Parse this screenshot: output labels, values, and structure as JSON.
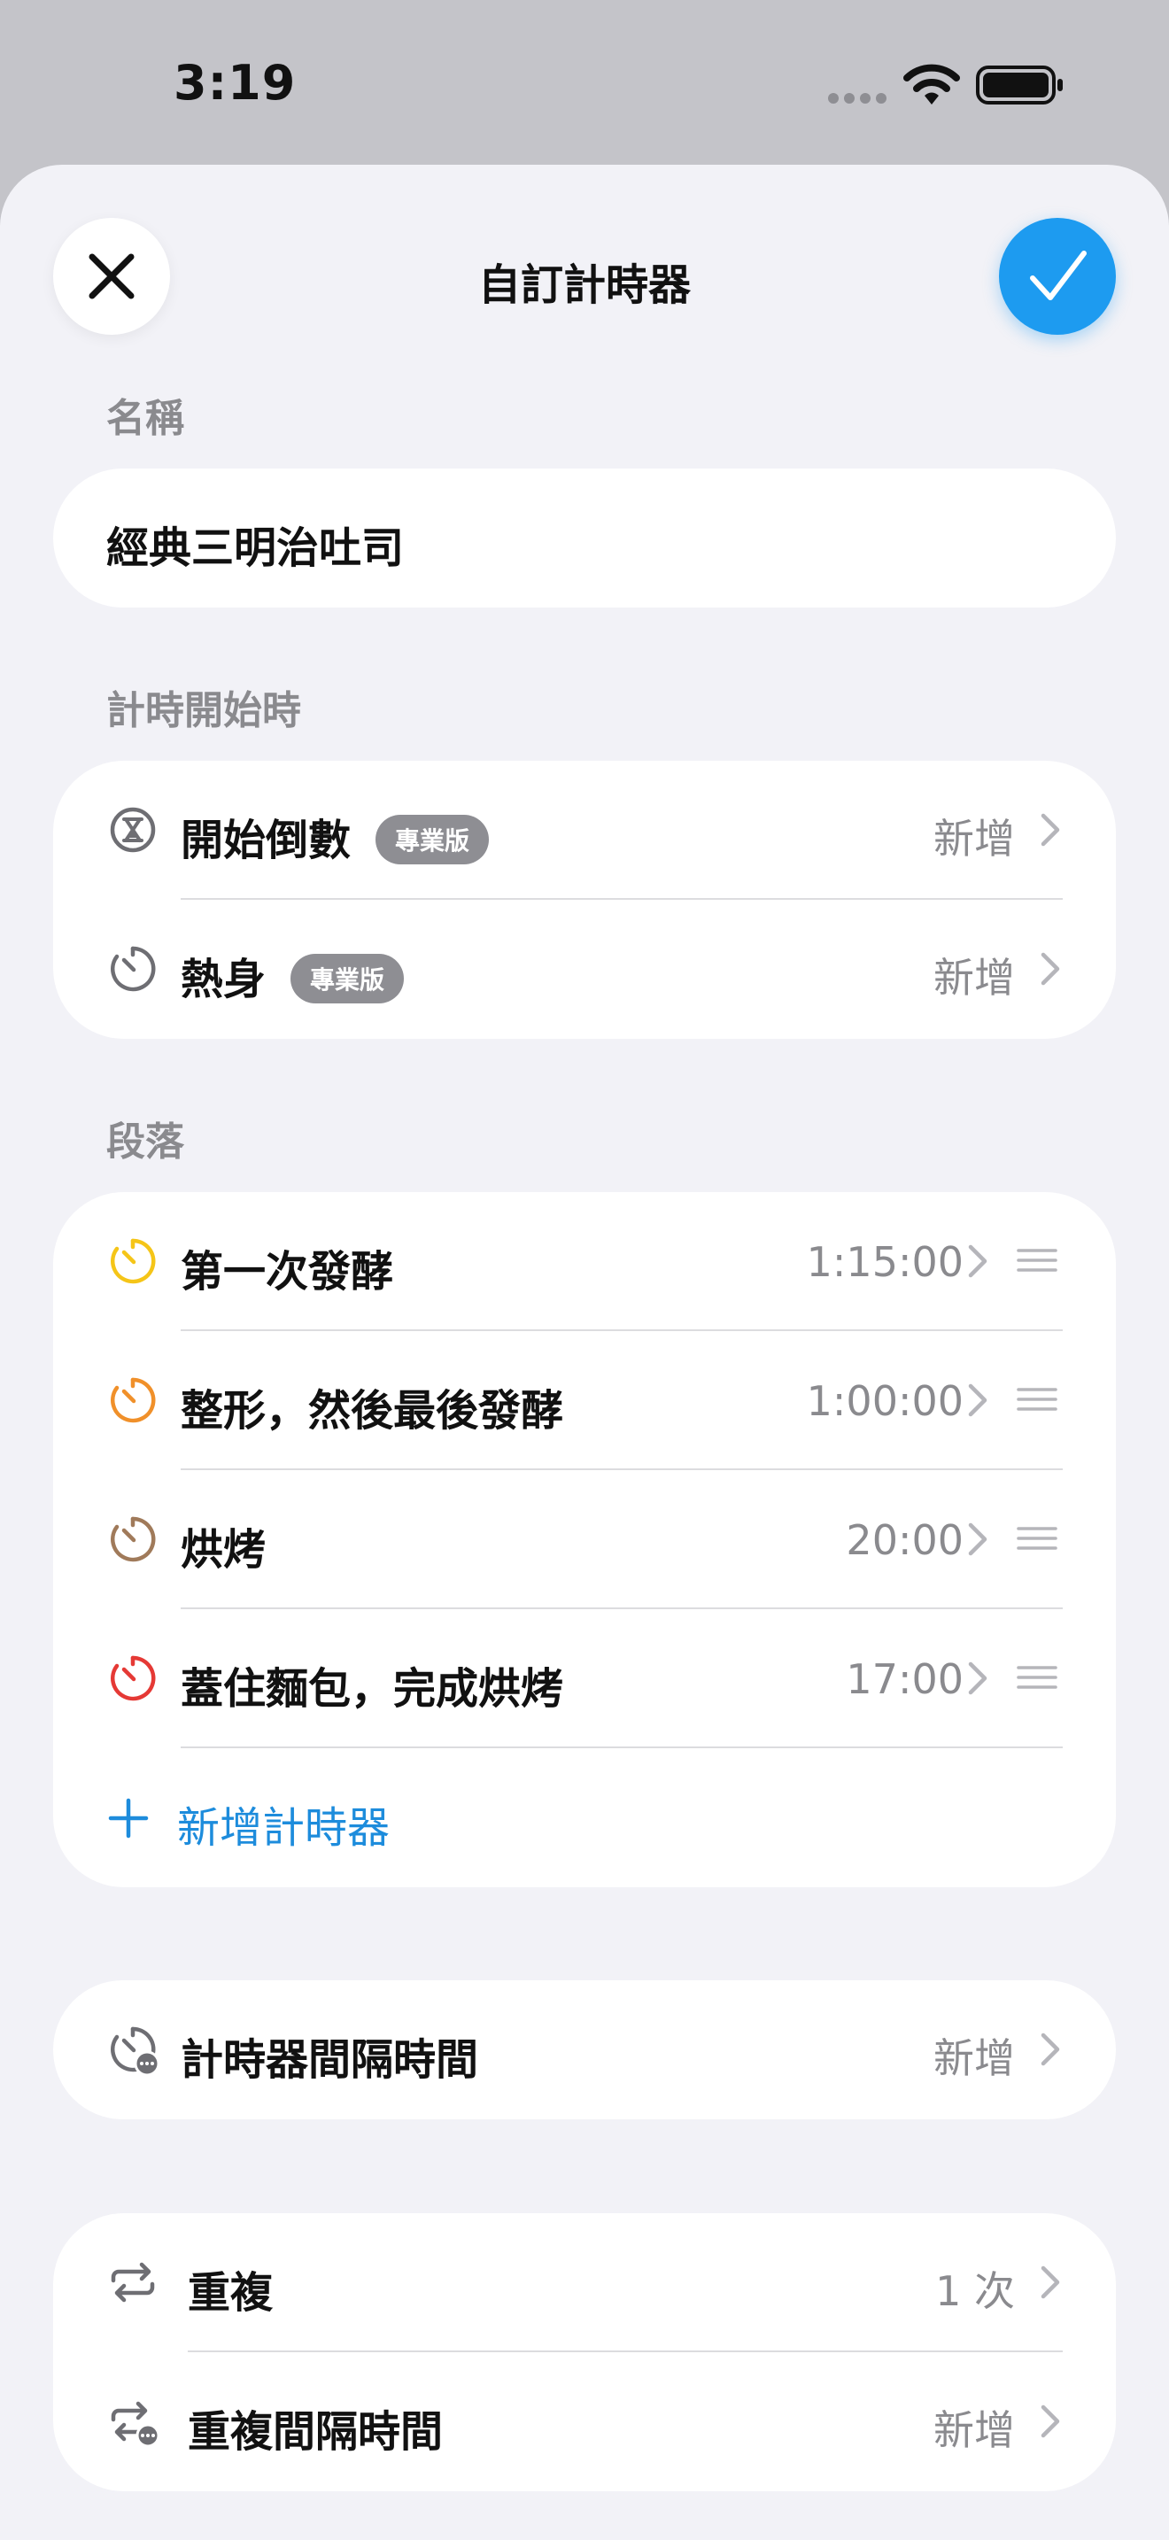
{
  "status_bar": {
    "time": "3:19"
  },
  "header": {
    "title": "自訂計時器",
    "close_icon": "close-icon",
    "done_icon": "checkmark-icon"
  },
  "name_section": {
    "label": "名稱",
    "value": "經典三明治吐司"
  },
  "start_section": {
    "label": "計時開始時",
    "rows": [
      {
        "label": "開始倒數",
        "badge": "專業版",
        "value": "新增",
        "icon": "hourglass-icon"
      },
      {
        "label": "熱身",
        "badge": "專業版",
        "value": "新增",
        "icon": "stopwatch-icon"
      }
    ]
  },
  "segments_section": {
    "label": "段落",
    "rows": [
      {
        "label": "第一次發酵",
        "value": "1:15:00",
        "color": "#f5c518"
      },
      {
        "label": "整形，然後最後發酵",
        "value": "1:00:00",
        "color": "#f0902a"
      },
      {
        "label": "烘烤",
        "value": "20:00",
        "color": "#a07a5a"
      },
      {
        "label": "蓋住麵包，完成烘烤",
        "value": "17:00",
        "color": "#e53935"
      }
    ],
    "add_label": "新增計時器",
    "accent": "#1d8cdc"
  },
  "interval_section": {
    "rows": [
      {
        "label": "計時器間隔時間",
        "value": "新增",
        "icon": "interval-timer-icon"
      }
    ]
  },
  "repeat_section": {
    "rows": [
      {
        "label": "重複",
        "value": "1 次",
        "icon": "repeat-icon"
      },
      {
        "label": "重複間隔時間",
        "value": "新增",
        "icon": "repeat-interval-icon"
      }
    ]
  }
}
